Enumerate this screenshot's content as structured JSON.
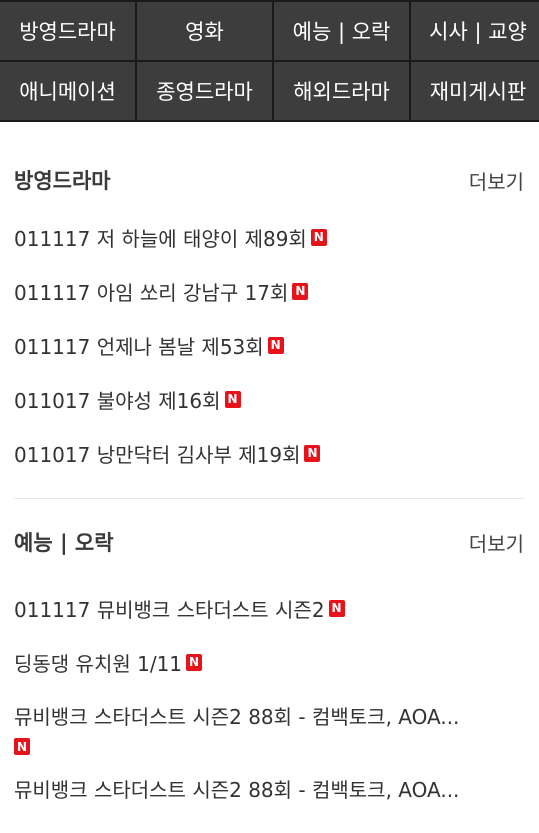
{
  "nav": {
    "items": [
      {
        "label": "방영드라마"
      },
      {
        "label": "영화"
      },
      {
        "label": "예능 | 오락"
      },
      {
        "label": "시사 | 교양"
      },
      {
        "label": "애니메이션"
      },
      {
        "label": "종영드라마"
      },
      {
        "label": "해외드라마"
      },
      {
        "label": "재미게시판"
      }
    ]
  },
  "badge_label": "N",
  "sections": [
    {
      "title": "방영드라마",
      "more_label": "더보기",
      "items": [
        {
          "text": "011117 저 하늘에 태양이 제89회"
        },
        {
          "text": "011117 아임 쏘리 강남구 17회"
        },
        {
          "text": "011117 언제나 봄날 제53회"
        },
        {
          "text": "011017 불야성 제16회"
        },
        {
          "text": "011017 낭만닥터 김사부 제19회"
        }
      ]
    },
    {
      "title": "예능 | 오락",
      "more_label": "더보기",
      "items": [
        {
          "text": "011117 뮤비뱅크 스타더스트 시즌2"
        },
        {
          "text": "딩동댕 유치원 1/11"
        },
        {
          "text": "뮤비뱅크 스타더스트 시즌2 88회 - 컴백토크, AOA..."
        },
        {
          "text": "뮤비뱅크 스타더스트 시즌2 88회 - 컴백토크, AOA..."
        }
      ]
    }
  ],
  "colors": {
    "nav_bg": "#3d3d3d",
    "nav_border": "#1a1a1a",
    "badge": "#e8121b"
  }
}
